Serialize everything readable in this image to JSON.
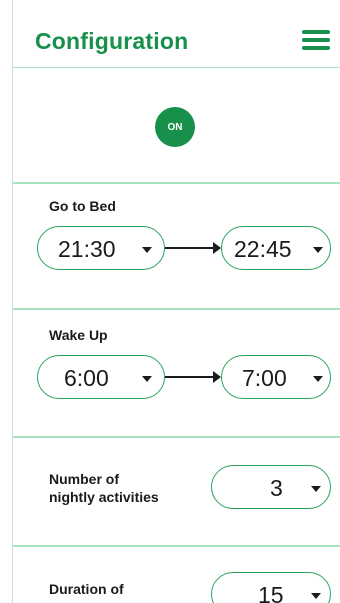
{
  "header": {
    "title": "Configuration",
    "menu_icon": "hamburger-menu-icon"
  },
  "power": {
    "label": "ON",
    "color": "#16904a"
  },
  "go_to_bed": {
    "label": "Go to Bed",
    "from": "21:30",
    "to": "22:45"
  },
  "wake_up": {
    "label": "Wake Up",
    "from": "6:00",
    "to": "7:00"
  },
  "activities_count": {
    "label_line1": "Number of",
    "label_line2": "nightly activities",
    "value": "3"
  },
  "activity_duration": {
    "label_line1": "Duration of",
    "value": "15"
  },
  "colors": {
    "accent": "#16904a",
    "divider": "#a8e3c0",
    "pill_border": "#29a35a"
  }
}
